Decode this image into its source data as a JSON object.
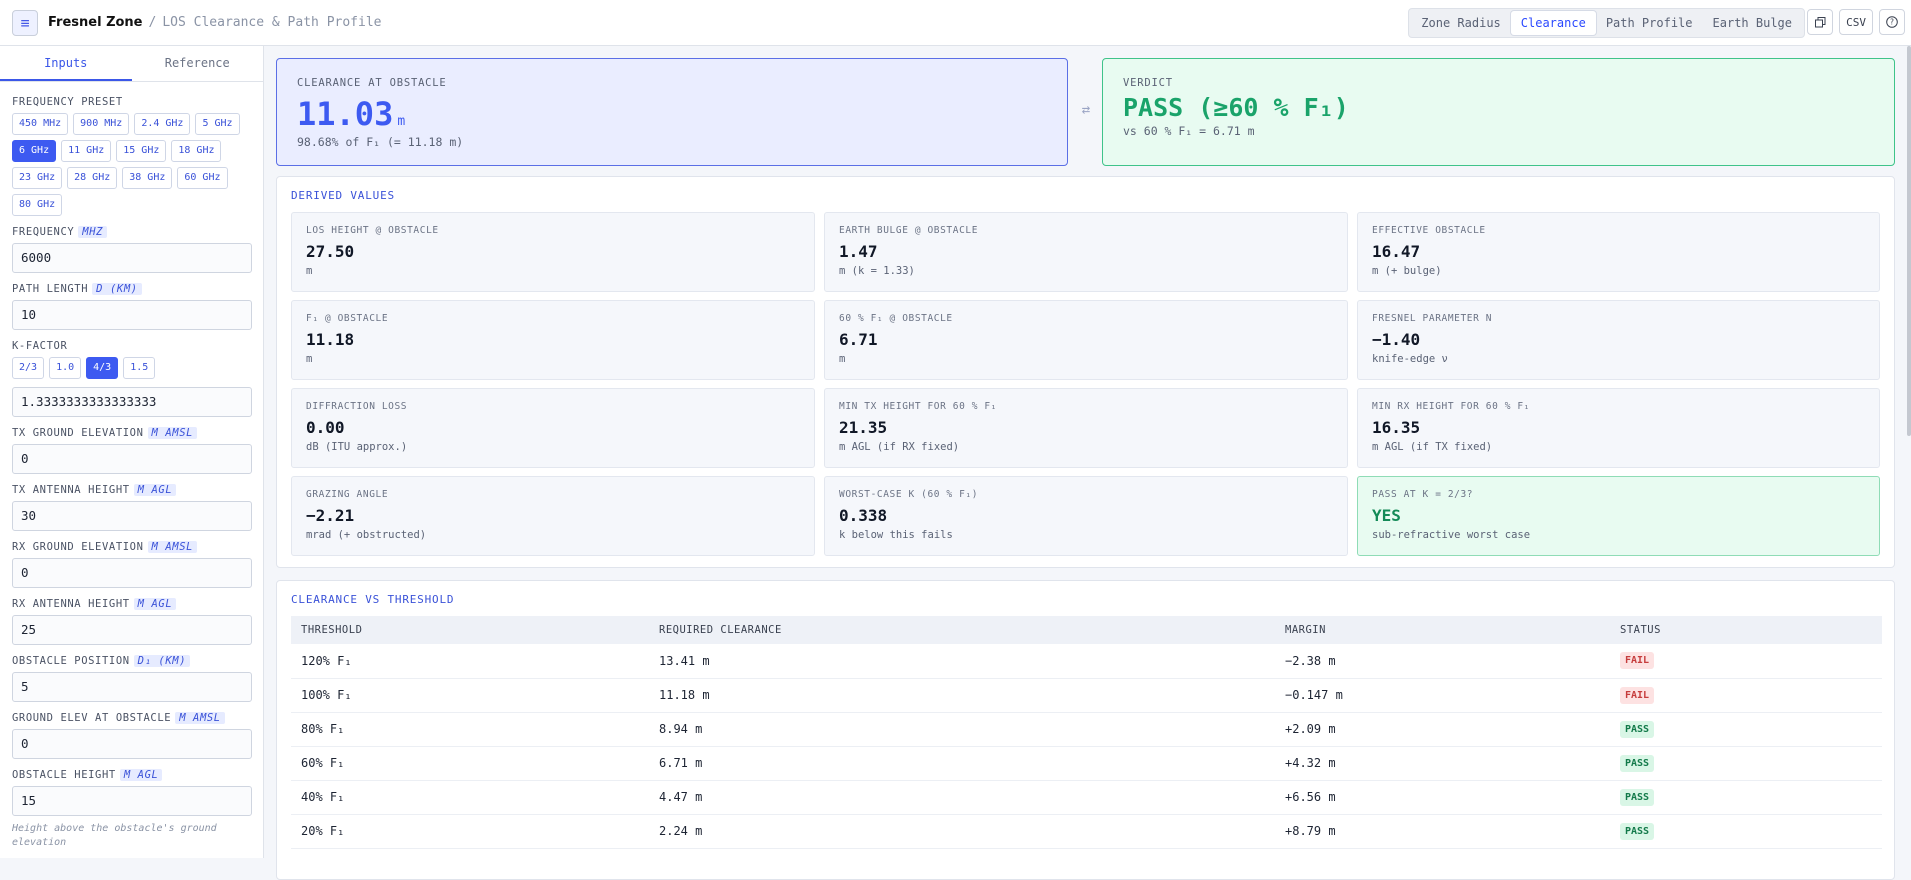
{
  "header": {
    "brand": "Fresnel Zone",
    "separator": "/",
    "subtitle": "LOS Clearance & Path Profile",
    "tabs": [
      {
        "label": "Zone Radius",
        "active": false
      },
      {
        "label": "Clearance",
        "active": true
      },
      {
        "label": "Path Profile",
        "active": false
      },
      {
        "label": "Earth Bulge",
        "active": false
      }
    ],
    "csv_label": "CSV"
  },
  "sidebar": {
    "tabs": [
      {
        "label": "Inputs",
        "active": true
      },
      {
        "label": "Reference",
        "active": false
      }
    ],
    "frequency_preset_label": "Frequency Preset",
    "presets": [
      {
        "label": "450 MHz",
        "active": false
      },
      {
        "label": "900 MHz",
        "active": false
      },
      {
        "label": "2.4 GHz",
        "active": false
      },
      {
        "label": "5 GHz",
        "active": false
      },
      {
        "label": "6 GHz",
        "active": true
      },
      {
        "label": "11 GHz",
        "active": false
      },
      {
        "label": "15 GHz",
        "active": false
      },
      {
        "label": "18 GHz",
        "active": false
      },
      {
        "label": "23 GHz",
        "active": false
      },
      {
        "label": "28 GHz",
        "active": false
      },
      {
        "label": "38 GHz",
        "active": false
      },
      {
        "label": "60 GHz",
        "active": false
      },
      {
        "label": "80 GHz",
        "active": false
      }
    ],
    "frequency": {
      "label": "Frequency",
      "unit": "MHz",
      "value": "6000"
    },
    "path_length": {
      "label": "Path Length",
      "unit": "d (km)",
      "value": "10"
    },
    "k_factor_label": "K-Factor",
    "k_presets": [
      {
        "label": "2/3",
        "active": false
      },
      {
        "label": "1.0",
        "active": false
      },
      {
        "label": "4/3",
        "active": true
      },
      {
        "label": "1.5",
        "active": false
      }
    ],
    "k_value": "1.3333333333333333",
    "tx_ground": {
      "label": "TX Ground Elevation",
      "unit": "m AMSL",
      "value": "0"
    },
    "tx_antenna": {
      "label": "TX Antenna Height",
      "unit": "m AGL",
      "value": "30"
    },
    "rx_ground": {
      "label": "RX Ground Elevation",
      "unit": "m AMSL",
      "value": "0"
    },
    "rx_antenna": {
      "label": "RX Antenna Height",
      "unit": "m AGL",
      "value": "25"
    },
    "obstacle_position": {
      "label": "Obstacle Position",
      "unit": "d₁ (km)",
      "value": "5"
    },
    "ground_elev_obstacle": {
      "label": "Ground Elev at Obstacle",
      "unit": "m AMSL",
      "value": "0"
    },
    "obstacle_height": {
      "label": "Obstacle Height",
      "unit": "m AGL",
      "value": "15"
    },
    "obstacle_hint": "Height above the obstacle's ground elevation"
  },
  "clearance": {
    "caption": "Clearance at Obstacle",
    "value": "11.03",
    "unit": "m",
    "sub": "98.68% of F₁ (= 11.18 m)"
  },
  "verdict": {
    "caption": "Verdict",
    "value": "PASS (≥60 % F₁)",
    "sub": "vs 60 % F₁ = 6.71 m"
  },
  "derived": {
    "title": "Derived Values",
    "cells": [
      {
        "caption": "LOS Height @ Obstacle",
        "value": "27.50",
        "sub": "m"
      },
      {
        "caption": "Earth Bulge @ Obstacle",
        "value": "1.47",
        "sub": "m (k = 1.33)"
      },
      {
        "caption": "Effective Obstacle",
        "value": "16.47",
        "sub": "m (+ bulge)"
      },
      {
        "caption": "F₁ @ Obstacle",
        "value": "11.18",
        "sub": "m"
      },
      {
        "caption": "60 % F₁ @ Obstacle",
        "value": "6.71",
        "sub": "m"
      },
      {
        "caption": "Fresnel Parameter ν",
        "value": "−1.40",
        "sub": "knife-edge ν"
      },
      {
        "caption": "Diffraction Loss",
        "value": "0.00",
        "sub": "dB (ITU approx.)"
      },
      {
        "caption": "Min TX Height for 60 % F₁",
        "value": "21.35",
        "sub": "m AGL (if RX fixed)"
      },
      {
        "caption": "Min RX Height for 60 % F₁",
        "value": "16.35",
        "sub": "m AGL (if TX fixed)"
      },
      {
        "caption": "Grazing Angle",
        "value": "−2.21",
        "sub": "mrad (+ obstructed)"
      },
      {
        "caption": "Worst-Case k (60 % F₁)",
        "value": "0.338",
        "sub": "k below this fails"
      },
      {
        "caption": "Pass at k = 2/3?",
        "value": "YES",
        "sub": "sub-refractive worst case",
        "pass": true
      }
    ]
  },
  "threshold": {
    "title": "Clearance vs Threshold",
    "columns": [
      "Threshold",
      "Required Clearance",
      "Margin",
      "Status"
    ],
    "rows": [
      {
        "threshold": "120% F₁",
        "required": "13.41 m",
        "margin": "−2.38 m",
        "status": "FAIL"
      },
      {
        "threshold": "100% F₁",
        "required": "11.18 m",
        "margin": "−0.147 m",
        "status": "FAIL"
      },
      {
        "threshold": "80% F₁",
        "required": "8.94 m",
        "margin": "+2.09 m",
        "status": "PASS"
      },
      {
        "threshold": "60% F₁",
        "required": "6.71 m",
        "margin": "+4.32 m",
        "status": "PASS"
      },
      {
        "threshold": "40% F₁",
        "required": "4.47 m",
        "margin": "+6.56 m",
        "status": "PASS"
      },
      {
        "threshold": "20% F₁",
        "required": "2.24 m",
        "margin": "+8.79 m",
        "status": "PASS"
      }
    ]
  }
}
